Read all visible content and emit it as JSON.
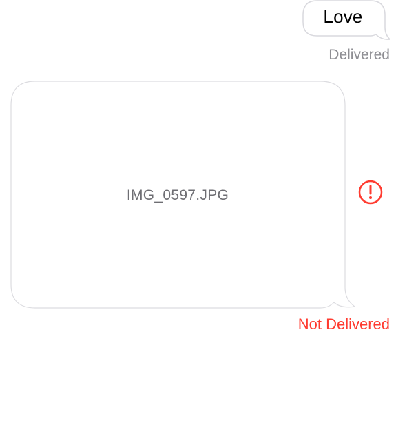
{
  "conversation": {
    "messages": [
      {
        "type": "text",
        "text": "Love",
        "status": "Delivered"
      },
      {
        "type": "image-attachment",
        "filename": "IMG_0597.JPG",
        "status": "Not Delivered",
        "error_icon": "exclamation-circle-icon"
      }
    ]
  },
  "colors": {
    "bubble_border": "#d9d9de",
    "status_gray": "#8e8e93",
    "error_red": "#ff3b30",
    "filename_gray": "#6e6e73"
  }
}
